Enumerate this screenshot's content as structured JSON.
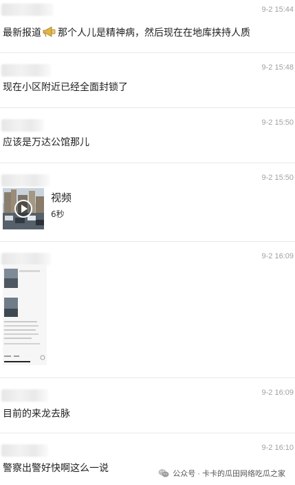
{
  "messages": [
    {
      "time": "9-2 15:44",
      "text_before": "最新报道",
      "icon": "trumpet-icon",
      "text_after": "那个人儿是精神病，然后现在在地库挟持人质"
    },
    {
      "time": "9-2 15:48",
      "text": "现在小区附近已经全面封锁了"
    },
    {
      "time": "9-2 15:50",
      "text": "应该是万达公馆那儿"
    },
    {
      "time": "9-2 15:50",
      "video": {
        "title": "视频",
        "duration": "6秒"
      }
    },
    {
      "time": "9-2 16:09",
      "image": "phone-screenshot"
    },
    {
      "time": "9-2 16:09",
      "text": "目前的来龙去脉"
    },
    {
      "time": "9-2 16:10",
      "text": "警察出警好快啊这么一说"
    }
  ],
  "footer": {
    "icon": "wechat-icon",
    "text": "公众号 · 卡卡的瓜田网络吃瓜之家"
  }
}
